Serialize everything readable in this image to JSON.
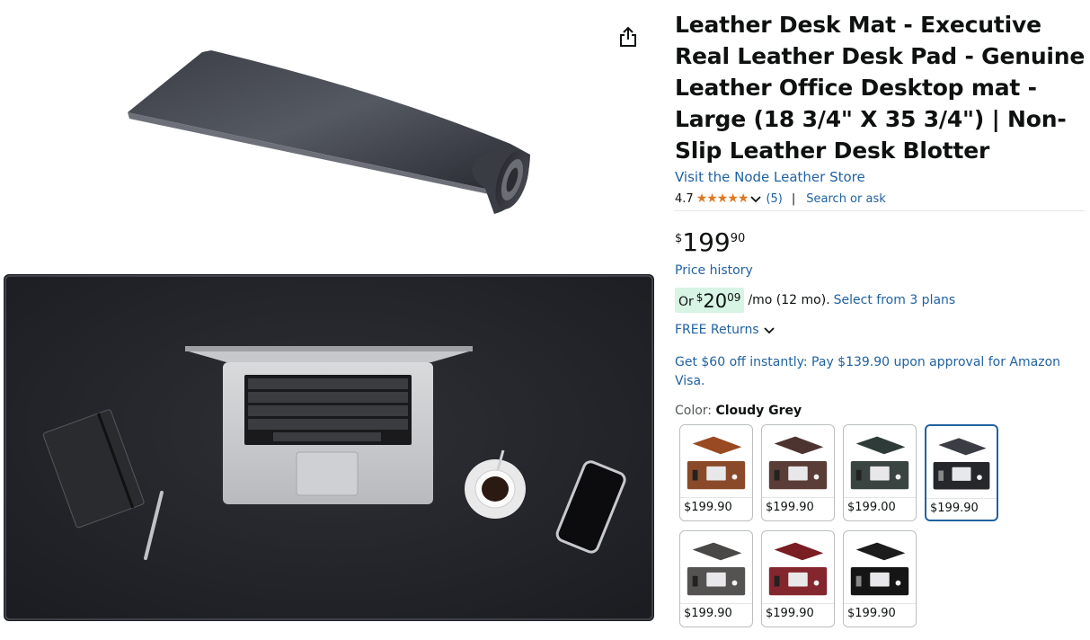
{
  "product": {
    "title": "Leather Desk Mat - Executive Real Leather Desk Pad - Genuine Leather Office Desktop mat - Large (18 3/4\" X 35 3/4\") | Non-Slip Leather Desk Blotter",
    "store_link": "Visit the Node Leather Store",
    "rating": "4.7",
    "stars_glyph": "★★★★★",
    "rating_value": 4.7,
    "review_count": "(5)",
    "divider": "|",
    "search_or_ask": "Search or ask",
    "price": {
      "symbol": "$",
      "whole": "199",
      "fraction": "90"
    },
    "price_history": "Price history",
    "installment": {
      "prefix": "Or",
      "symbol": "$",
      "whole": "20",
      "fraction": "09",
      "term": "/mo (12 mo).",
      "plans_link": "Select from 3 plans"
    },
    "free_returns": "FREE Returns",
    "promo": "Get $60 off instantly: Pay $139.90 upon approval for Amazon Visa.",
    "color_label": "Color:",
    "color_value": "Cloudy Grey"
  },
  "swatches": [
    {
      "price": "$199.90",
      "color": "#9a4a22",
      "mat": "#8a4a2a",
      "selected": false
    },
    {
      "price": "$199.90",
      "color": "#4e3430",
      "mat": "#5a3d36",
      "selected": false
    },
    {
      "price": "$199.00",
      "color": "#2f3b38",
      "mat": "#3a4542",
      "selected": false
    },
    {
      "price": "$199.90",
      "color": "#3a3d44",
      "mat": "#25272b",
      "selected": true
    },
    {
      "price": "$199.90",
      "color": "#4a4747",
      "mat": "#555252",
      "selected": false
    },
    {
      "price": "$199.90",
      "color": "#7a1e24",
      "mat": "#84262d",
      "selected": false
    },
    {
      "price": "$199.90",
      "color": "#1c1c1c",
      "mat": "#151515",
      "selected": false
    }
  ],
  "colors": {
    "link": "#2162a1",
    "star": "#de7921",
    "installment_bg": "#d7f4e4",
    "selected_border": "#2162a1"
  },
  "icons": {
    "share": "share-icon",
    "chevron": "chevron-down-icon"
  }
}
